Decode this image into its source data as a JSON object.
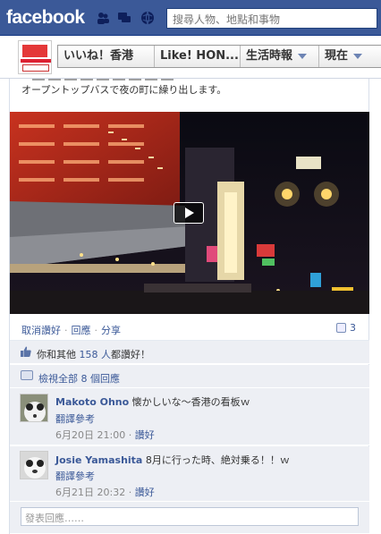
{
  "topbar": {
    "logo": "facebook",
    "search_placeholder": "搜尋人物、地點和事物",
    "brand_color": "#3b5998"
  },
  "page_header": {
    "thumb_text": "いいね！香港",
    "nav": [
      {
        "label": "いいね！香港"
      },
      {
        "label": "Like! HON..."
      },
      {
        "label": "生活時報"
      },
      {
        "label": "現在"
      }
    ]
  },
  "post": {
    "caption": "オープントップバスで夜の町に繰り出します。"
  },
  "actions": {
    "unlike": "取消讚好",
    "comment": "回應",
    "share": "分享",
    "share_count": "3"
  },
  "likes": {
    "prefix": "你和其他 ",
    "people": "158 人",
    "suffix": "都讚好！"
  },
  "view_all": "檢視全部 8 個回應",
  "comments": [
    {
      "author": "Makoto Ohno",
      "text": "懐かしいな～香港の看板ｗ",
      "translate": "翻譯參考",
      "time": "6月20日 21:00",
      "like": "讚好"
    },
    {
      "author": "Josie Yamashita",
      "text": "8月に行った時、絶対乗る！！ｗ",
      "translate": "翻譯參考",
      "time": "6月21日 20:32",
      "like": "讚好"
    }
  ],
  "composer": {
    "placeholder": "發表回應……"
  }
}
